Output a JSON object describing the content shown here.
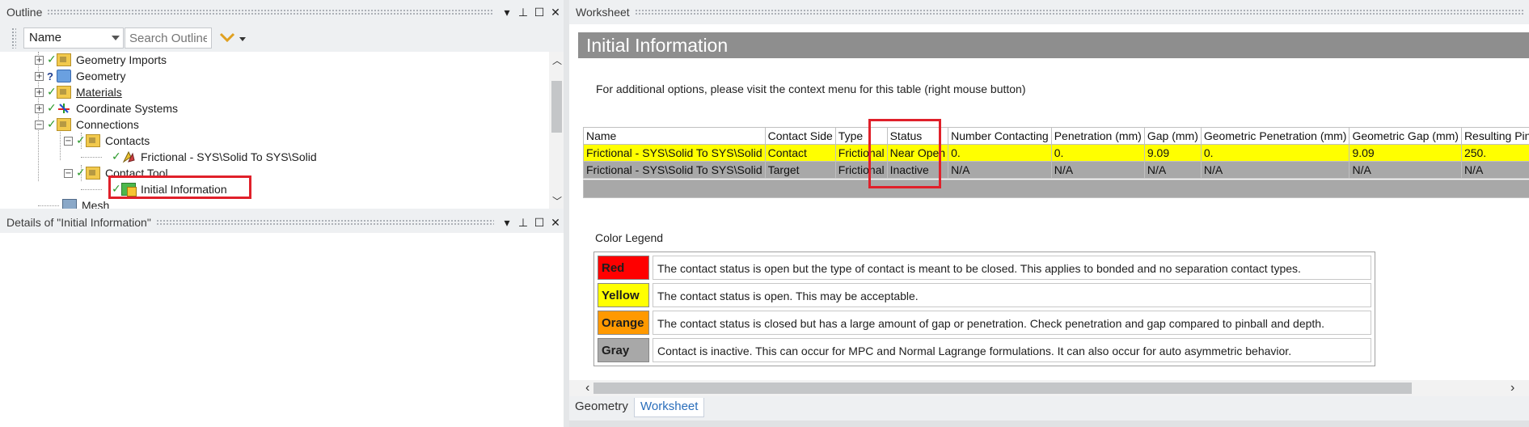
{
  "outline": {
    "title": "Outline",
    "controls": {
      "dropdown": "▾",
      "pin": "📌",
      "maximize": "☐",
      "close": "✕"
    },
    "name_select": "Name",
    "search_placeholder": "Search Outline",
    "tree": [
      {
        "label": "Geometry Imports",
        "status": "check",
        "icon": "folder-icon",
        "expander": "+"
      },
      {
        "label": "Geometry",
        "status": "question",
        "icon": "geometry-icon",
        "expander": "+"
      },
      {
        "label": "Materials",
        "status": "check",
        "icon": "folder-icon",
        "expander": "+"
      },
      {
        "label": "Coordinate Systems",
        "status": "check",
        "icon": "coordinate-system-icon",
        "expander": "+"
      },
      {
        "label": "Connections",
        "status": "check",
        "icon": "folder-icon",
        "expander": "−"
      },
      {
        "label": "Contacts",
        "status": "check",
        "icon": "folder-icon",
        "expander": "−"
      },
      {
        "label": "Frictional - SYS\\Solid To SYS\\Solid",
        "status": "check",
        "icon": "contact-icon"
      },
      {
        "label": "Contact Tool",
        "status": "check",
        "icon": "folder-icon",
        "expander": "−"
      },
      {
        "label": "Initial Information",
        "status": "check",
        "icon": "initial-information-icon"
      },
      {
        "label": "Mesh",
        "status": "none",
        "icon": "mesh-icon"
      }
    ]
  },
  "details": {
    "title": "Details of \"Initial Information\""
  },
  "worksheet": {
    "panel_title": "Worksheet",
    "title": "Initial Information",
    "hint": "For additional options, please visit the context menu for this table (right mouse button)",
    "table": {
      "headers": [
        "Name",
        "Contact Side",
        "Type",
        "Status",
        "Number Contacting",
        "Penetration (mm)",
        "Gap (mm)",
        "Geometric Penetration (mm)",
        "Geometric Gap (mm)",
        "Resulting Pinball ("
      ],
      "rows": [
        [
          "Frictional - SYS\\Solid To SYS\\Solid",
          "Contact",
          "Frictional",
          "Near Open",
          "0.",
          "0.",
          "9.09",
          "0.",
          "9.09",
          "250."
        ],
        [
          "Frictional - SYS\\Solid To SYS\\Solid",
          "Target",
          "Frictional",
          "Inactive",
          "N/A",
          "N/A",
          "N/A",
          "N/A",
          "N/A",
          "N/A"
        ]
      ]
    },
    "legend_title": "Color Legend",
    "legend": [
      {
        "name": "Red",
        "color": "#ff0000",
        "text": "The contact status is open but the type of contact is meant to be closed. This applies to bonded and no separation contact types."
      },
      {
        "name": "Yellow",
        "color": "#ffff00",
        "text": "The contact status is open. This may be acceptable."
      },
      {
        "name": "Orange",
        "color": "#ff9900",
        "text": "The contact status is closed but has a large amount of gap or penetration. Check penetration and gap compared to pinball and depth."
      },
      {
        "name": "Gray",
        "color": "#a8a8a8",
        "text": "Contact is inactive. This can occur for MPC and Normal Lagrange formulations. It can also occur for auto asymmetric behavior."
      }
    ],
    "tabs": [
      "Geometry",
      "Worksheet"
    ],
    "active_tab": "Worksheet"
  },
  "colors": {
    "highlight": "#e0202a",
    "row_active": "#ffff00",
    "row_inactive": "#a8a8a8",
    "title_bar": "#8e8e8e"
  }
}
